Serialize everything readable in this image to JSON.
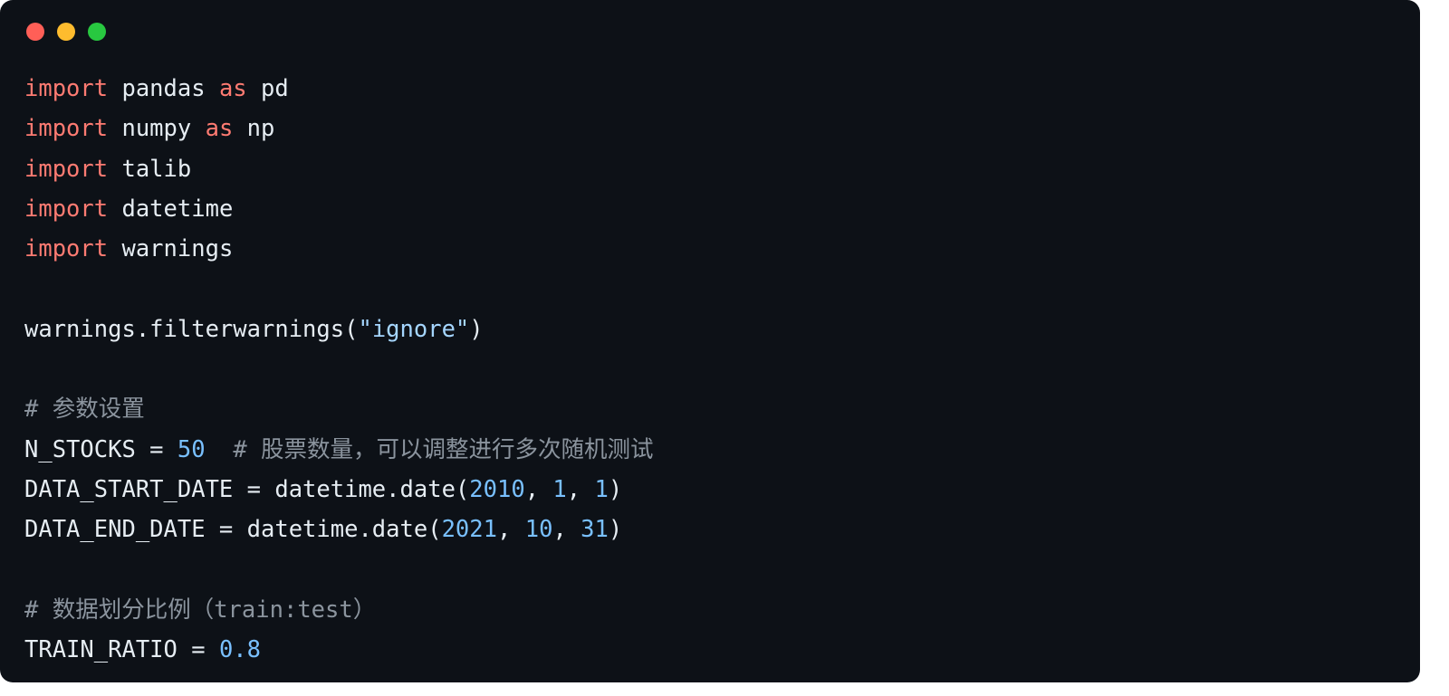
{
  "window": {
    "controls": [
      {
        "name": "close",
        "color": "#ff5f57"
      },
      {
        "name": "minimize",
        "color": "#febc2e"
      },
      {
        "name": "zoom",
        "color": "#28c840"
      }
    ]
  },
  "colors": {
    "background": "#0d1117",
    "keyword": "#ff7b72",
    "number": "#79c0ff",
    "string": "#a5d6ff",
    "comment": "#8b949e",
    "text": "#e6edf3"
  },
  "code": {
    "language": "python",
    "lines": [
      [
        {
          "t": "kw",
          "v": "import"
        },
        {
          "t": "plain",
          "v": " pandas "
        },
        {
          "t": "kw",
          "v": "as"
        },
        {
          "t": "plain",
          "v": " pd"
        }
      ],
      [
        {
          "t": "kw",
          "v": "import"
        },
        {
          "t": "plain",
          "v": " numpy "
        },
        {
          "t": "kw",
          "v": "as"
        },
        {
          "t": "plain",
          "v": " np"
        }
      ],
      [
        {
          "t": "kw",
          "v": "import"
        },
        {
          "t": "plain",
          "v": " talib"
        }
      ],
      [
        {
          "t": "kw",
          "v": "import"
        },
        {
          "t": "plain",
          "v": " datetime"
        }
      ],
      [
        {
          "t": "kw",
          "v": "import"
        },
        {
          "t": "plain",
          "v": " warnings"
        }
      ],
      [],
      [
        {
          "t": "plain",
          "v": "warnings.filterwarnings("
        },
        {
          "t": "str",
          "v": "\"ignore\""
        },
        {
          "t": "plain",
          "v": ")"
        }
      ],
      [],
      [
        {
          "t": "com",
          "v": "# 参数设置"
        }
      ],
      [
        {
          "t": "plain",
          "v": "N_STOCKS = "
        },
        {
          "t": "num",
          "v": "50"
        },
        {
          "t": "plain",
          "v": "  "
        },
        {
          "t": "com",
          "v": "# 股票数量，可以调整进行多次随机测试"
        }
      ],
      [
        {
          "t": "plain",
          "v": "DATA_START_DATE = datetime.date("
        },
        {
          "t": "num",
          "v": "2010"
        },
        {
          "t": "plain",
          "v": ", "
        },
        {
          "t": "num",
          "v": "1"
        },
        {
          "t": "plain",
          "v": ", "
        },
        {
          "t": "num",
          "v": "1"
        },
        {
          "t": "plain",
          "v": ")"
        }
      ],
      [
        {
          "t": "plain",
          "v": "DATA_END_DATE = datetime.date("
        },
        {
          "t": "num",
          "v": "2021"
        },
        {
          "t": "plain",
          "v": ", "
        },
        {
          "t": "num",
          "v": "10"
        },
        {
          "t": "plain",
          "v": ", "
        },
        {
          "t": "num",
          "v": "31"
        },
        {
          "t": "plain",
          "v": ")"
        }
      ],
      [],
      [
        {
          "t": "com",
          "v": "# 数据划分比例（train:test）"
        }
      ],
      [
        {
          "t": "plain",
          "v": "TRAIN_RATIO = "
        },
        {
          "t": "num",
          "v": "0.8"
        }
      ]
    ]
  }
}
